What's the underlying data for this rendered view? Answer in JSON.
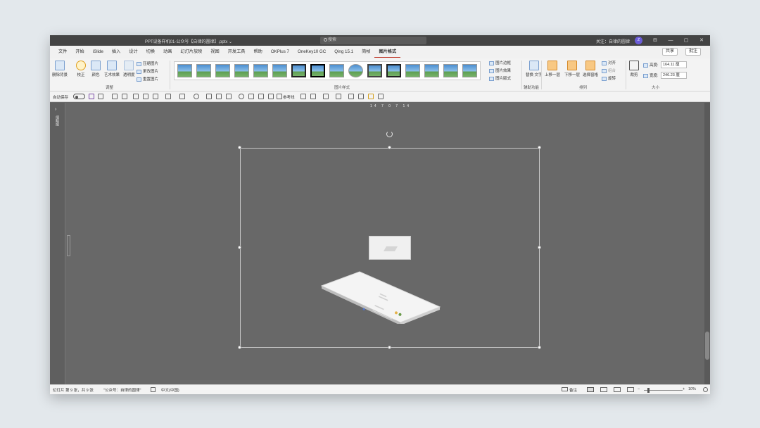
{
  "titlebar": {
    "document": "PPT设备样机01-公众号【自律的圆律】.pptx ⌄",
    "search_placeholder": "搜索",
    "follow_label": "关注：自律的圆律",
    "avatar_initial": "Z",
    "controls": [
      "⊟",
      "—",
      "▢",
      "✕"
    ]
  },
  "tabs": [
    "文件",
    "开始",
    "iSlide",
    "插入",
    "设计",
    "切换",
    "动画",
    "幻灯片放映",
    "视图",
    "开发工具",
    "帮助",
    "OKPlus 7",
    "OneKey10 GC",
    "Qing 15.1",
    "简帧",
    "图片格式"
  ],
  "active_tab": "图片格式",
  "share_label": "共享",
  "comment_label": "批注",
  "ribbon": {
    "adjust": {
      "remove_bg": "删除背景",
      "correct": "校正",
      "color": "颜色",
      "artistic": "艺术效果",
      "transparency": "透明度",
      "compress": "压缩图片",
      "change": "更改图片",
      "reset": "重置图片",
      "group_label": "调整"
    },
    "styles": {
      "border": "图片边框",
      "effects": "图片效果",
      "layout": "图片版式",
      "group_label": "图片样式"
    },
    "accessibility": {
      "alt_text": "替换\n文字",
      "group_label": "辅助功能"
    },
    "arrange": {
      "forward": "上移一层",
      "backward": "下移一层",
      "selection_pane": "选择窗格",
      "align": "对齐",
      "group": "组合",
      "rotate": "旋转",
      "group_label": "排列"
    },
    "size": {
      "crop": "裁剪",
      "height_label": "高度:",
      "height_value": "164.11 厘",
      "width_label": "宽度:",
      "width_value": "246.23 厘",
      "group_label": "大小"
    }
  },
  "qat": {
    "autosave_label": "自动保存",
    "toggle_state": "关",
    "ref_line_label": "参考线"
  },
  "ruler_text": "14  7  0  7  14",
  "left_pane_label": "缩略图",
  "status": {
    "slide_info": "幻灯片 第 9 张，共 9 张",
    "theme": "\"公众号：自律的圆律\"",
    "language": "中文(中国)",
    "notes": "备注",
    "zoom": "10%"
  }
}
